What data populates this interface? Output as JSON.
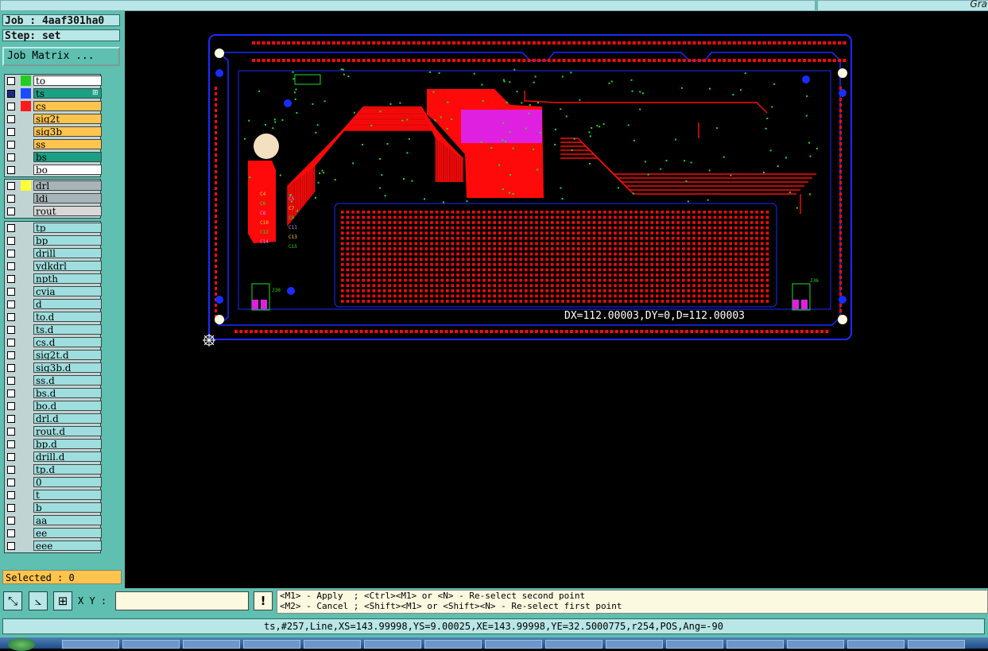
{
  "topbar": {
    "right_text": "Gra"
  },
  "job": {
    "label": "Job : 4aaf301ha0",
    "step": "Step: set",
    "matrix_button": "Job Matrix ..."
  },
  "layers_group1": [
    {
      "name": "to",
      "bg": "#ffffff",
      "swatch": "#22cc22",
      "checked": false
    },
    {
      "name": "ts",
      "bg": "#1aa084",
      "swatch": "#1a4dff",
      "checked": true,
      "active": true
    },
    {
      "name": "cs",
      "bg": "#ffc44d",
      "swatch": "#ff1a1a",
      "checked": false
    },
    {
      "name": "sig2t",
      "bg": "#ffc44d",
      "swatch": "",
      "checked": false
    },
    {
      "name": "sig3b",
      "bg": "#ffc44d",
      "swatch": "",
      "checked": false
    },
    {
      "name": "ss",
      "bg": "#ffc44d",
      "swatch": "",
      "checked": false
    },
    {
      "name": "bs",
      "bg": "#1aa084",
      "swatch": "",
      "checked": false
    },
    {
      "name": "bo",
      "bg": "#ffffff",
      "swatch": "",
      "checked": false
    }
  ],
  "layers_group2": [
    {
      "name": "drl",
      "bg": "#a8b4b8",
      "swatch": "#ffff33",
      "checked": false
    },
    {
      "name": "ldi",
      "bg": "#a8b4b8",
      "swatch": "",
      "checked": false
    },
    {
      "name": "rout",
      "bg": "#d8d8d8",
      "swatch": "",
      "checked": false
    }
  ],
  "layers_group3": [
    "tp",
    "bp",
    "drill",
    "ydkdrl",
    "npth",
    "cvia",
    "d",
    "to.d",
    "ts.d",
    "cs.d",
    "sig2t.d",
    "sig3b.d",
    "ss.d",
    "bs.d",
    "bo.d",
    "drl.d",
    "rout.d",
    "bp.d",
    "drill.d",
    "tp.d",
    "0",
    "t",
    "b",
    "aa",
    "ee",
    "eee"
  ],
  "selected": "Selected : 0",
  "toolbar": {
    "xy_label": "X Y :",
    "xy_value": "",
    "warn_icon": "!"
  },
  "help": {
    "line1": "<M1> - Apply  ; <Ctrl><M1> or <N> - Re-select second point",
    "line2": "<M2> - Cancel ; <Shift><M1> or <Shift><N> - Re-select first point"
  },
  "status": "ts,#257,Line,XS=143.99998,YS=9.00025,XE=143.99998,YE=32.5000775,r254,POS,Ang=-90",
  "measure": "DX=112.00003,DY=0,D=112.00003",
  "board": {
    "outline_color": "#1a2cff",
    "copper_color": "#ff0a0a",
    "highlight_color": "#e020e0",
    "labels": [
      "C4",
      "C5",
      "C6",
      "C7",
      "C8",
      "C9",
      "C10",
      "C11",
      "C12",
      "C13",
      "C14",
      "C15"
    ],
    "connector_left": "J30",
    "connector_right": "J36"
  }
}
